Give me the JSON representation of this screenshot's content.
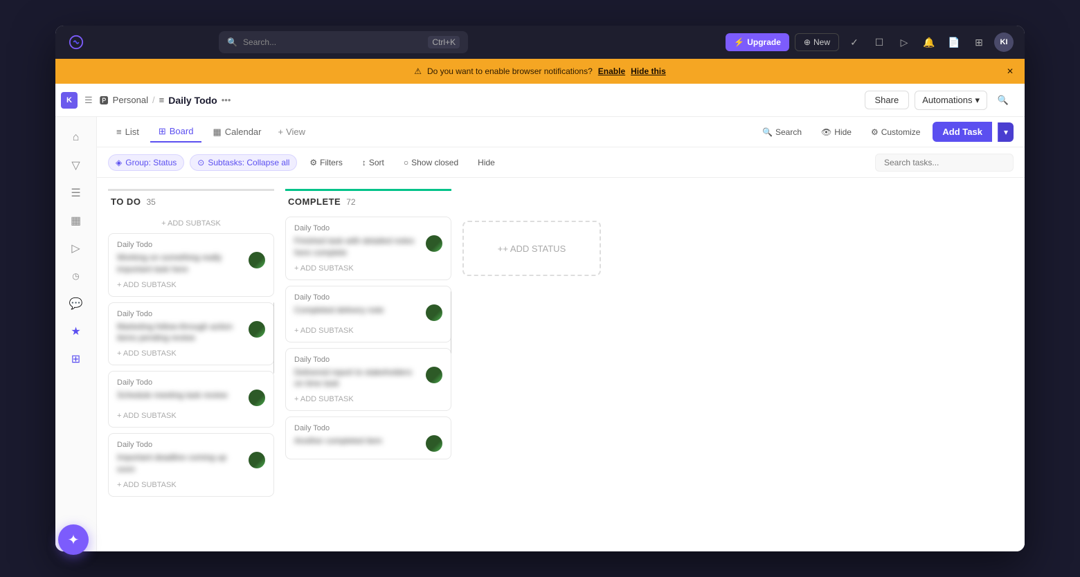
{
  "appLogo": "↺",
  "topNav": {
    "search": {
      "placeholder": "Search...",
      "shortcut": "Ctrl+K"
    },
    "upgradeLabel": "Upgrade",
    "newLabel": "New",
    "avatarLabel": "KI"
  },
  "notification": {
    "icon": "⚠",
    "text": "Do you want to enable browser notifications?",
    "enableLabel": "Enable",
    "hideLabel": "Hide this"
  },
  "header": {
    "avatar": "K",
    "breadcrumb": {
      "workspace": "Personal",
      "separator": "/",
      "pageIcon": "≡",
      "pageTitle": "Daily Todo"
    },
    "shareLabel": "Share",
    "automationsLabel": "Automations"
  },
  "tabs": {
    "items": [
      {
        "icon": "≡",
        "label": "List",
        "active": false
      },
      {
        "icon": "⊞",
        "label": "Board",
        "active": true
      },
      {
        "icon": "▦",
        "label": "Calendar",
        "active": false
      }
    ],
    "addViewLabel": "+ View",
    "rightButtons": {
      "search": "Search",
      "hide": "Hide",
      "customize": "Customize"
    },
    "addTaskLabel": "Add Task"
  },
  "filterBar": {
    "chips": [
      {
        "label": "Group: Status"
      },
      {
        "label": "Subtasks: Collapse all"
      }
    ],
    "filterLabel": "Filters",
    "sortLabel": "Sort",
    "showClosedLabel": "Show closed",
    "hideLabel": "Hide",
    "searchPlaceholder": "Search tasks..."
  },
  "board": {
    "columns": [
      {
        "id": "todo",
        "title": "TO DO",
        "count": "35",
        "colorClass": "column-todo",
        "cards": [
          {
            "project": "Daily Todo",
            "text": "blurred-text-1",
            "blurred": true
          },
          {
            "project": "Daily Todo",
            "text": "blurred-text-2",
            "blurred": true
          },
          {
            "project": "Daily Todo",
            "text": "blurred-text-3",
            "blurred": true
          },
          {
            "project": "Daily Todo",
            "text": "blurred-text-4",
            "blurred": true
          }
        ],
        "addSubtaskLabel": "+ ADD SUBTASK"
      },
      {
        "id": "complete",
        "title": "COMPLETE",
        "count": "72",
        "colorClass": "column-complete",
        "cards": [
          {
            "project": "Daily Todo",
            "text": "blurred-complete-1",
            "blurred": true
          },
          {
            "project": "Daily Todo",
            "text": "blurred-complete-2",
            "blurred": true
          },
          {
            "project": "Daily Todo",
            "text": "blurred-complete-3",
            "blurred": true
          },
          {
            "project": "Daily Todo",
            "text": "blurred-complete-4",
            "blurred": true
          }
        ],
        "addSubtaskLabel": "+ ADD SUBTASK"
      }
    ],
    "addStatusLabel": "+ ADD STATUS"
  },
  "sidebar": {
    "icons": [
      {
        "name": "home-icon",
        "symbol": "⌂"
      },
      {
        "name": "inbox-icon",
        "symbol": "▽"
      },
      {
        "name": "doc-icon",
        "symbol": "☰"
      },
      {
        "name": "chart-icon",
        "symbol": "▦"
      },
      {
        "name": "play-icon",
        "symbol": "▷"
      },
      {
        "name": "clock-icon",
        "symbol": "○"
      },
      {
        "name": "chat-icon",
        "symbol": "◯"
      },
      {
        "name": "star-icon",
        "symbol": "★"
      },
      {
        "name": "grid-icon",
        "symbol": "⊞"
      }
    ]
  },
  "fab": {
    "symbol": "✦"
  }
}
